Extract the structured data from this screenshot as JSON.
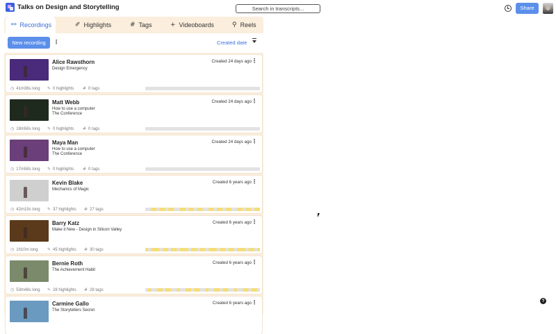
{
  "app": {
    "title": "Talks on Design and Storytelling"
  },
  "search": {
    "placeholder": "Search in transcripts..."
  },
  "header": {
    "share_label": "Share"
  },
  "tabs": [
    {
      "label": "Recordings",
      "icon": "recordings-icon",
      "active": true
    },
    {
      "label": "Highlights",
      "icon": "highlighter-icon",
      "active": false
    },
    {
      "label": "Tags",
      "icon": "hash-icon",
      "active": false
    },
    {
      "label": "Videoboards",
      "icon": "plus-icon",
      "active": false
    },
    {
      "label": "Reels",
      "icon": "reels-icon",
      "active": false
    }
  ],
  "toolbar": {
    "new_label": "New recording",
    "sort_label": "Created date"
  },
  "colors": {
    "accent": "#5b8fea",
    "panel": "#fbeedd",
    "highlight_bar": "#f5dd7a",
    "empty_bar": "#e2e2e2"
  },
  "recordings": [
    {
      "name": "Alice Rawsthorn",
      "subtitle": [
        "Design Emergency"
      ],
      "created": "Created 24 days ago",
      "length": "41m36s long",
      "highlights": "0 highlights",
      "tags": "0 tags",
      "highlight_fraction": 0.0,
      "thumb": "#4a2a7a"
    },
    {
      "name": "Matt Webb",
      "subtitle": [
        "How to use a computer",
        "The Conference"
      ],
      "created": "Created 24 days ago",
      "length": "18m56s long",
      "highlights": "0 highlights",
      "tags": "0 tags",
      "highlight_fraction": 0.0,
      "thumb": "#1e2a1e"
    },
    {
      "name": "Maya Man",
      "subtitle": [
        "How to use a computer",
        "The Conference"
      ],
      "created": "Created 24 days ago",
      "length": "17m58s long",
      "highlights": "0 highlights",
      "tags": "0 tags",
      "highlight_fraction": 0.0,
      "thumb": "#6a3f7a"
    },
    {
      "name": "Kevin Blake",
      "subtitle": [
        "Mechanics of Magic"
      ],
      "created": "Created 6 years ago",
      "length": "42m19s long",
      "highlights": "37 highlights",
      "tags": "27 tags",
      "highlight_fraction": 0.55,
      "thumb": "#cfcfcf"
    },
    {
      "name": "Barry Katz",
      "subtitle": [
        "Make it New - Design in Silicon Valley"
      ],
      "created": "Created 6 years ago",
      "length": "1h10m long",
      "highlights": "45 highlights",
      "tags": "30 tags",
      "highlight_fraction": 0.7,
      "thumb": "#5a3a1a"
    },
    {
      "name": "Bernie Roth",
      "subtitle": [
        "The Achievement Habit"
      ],
      "created": "Created 6 years ago",
      "length": "53m48s long",
      "highlights": "28 highlights",
      "tags": "28 tags",
      "highlight_fraction": 0.45,
      "thumb": "#7a8a6a"
    },
    {
      "name": "Carmine Gallo",
      "subtitle": [
        "The Storytellers Secret"
      ],
      "created": "Created 6 years ago",
      "length": "",
      "highlights": "",
      "tags": "",
      "highlight_fraction": 0.0,
      "thumb": "#6a9ac0"
    }
  ],
  "help": {
    "label": "?"
  }
}
